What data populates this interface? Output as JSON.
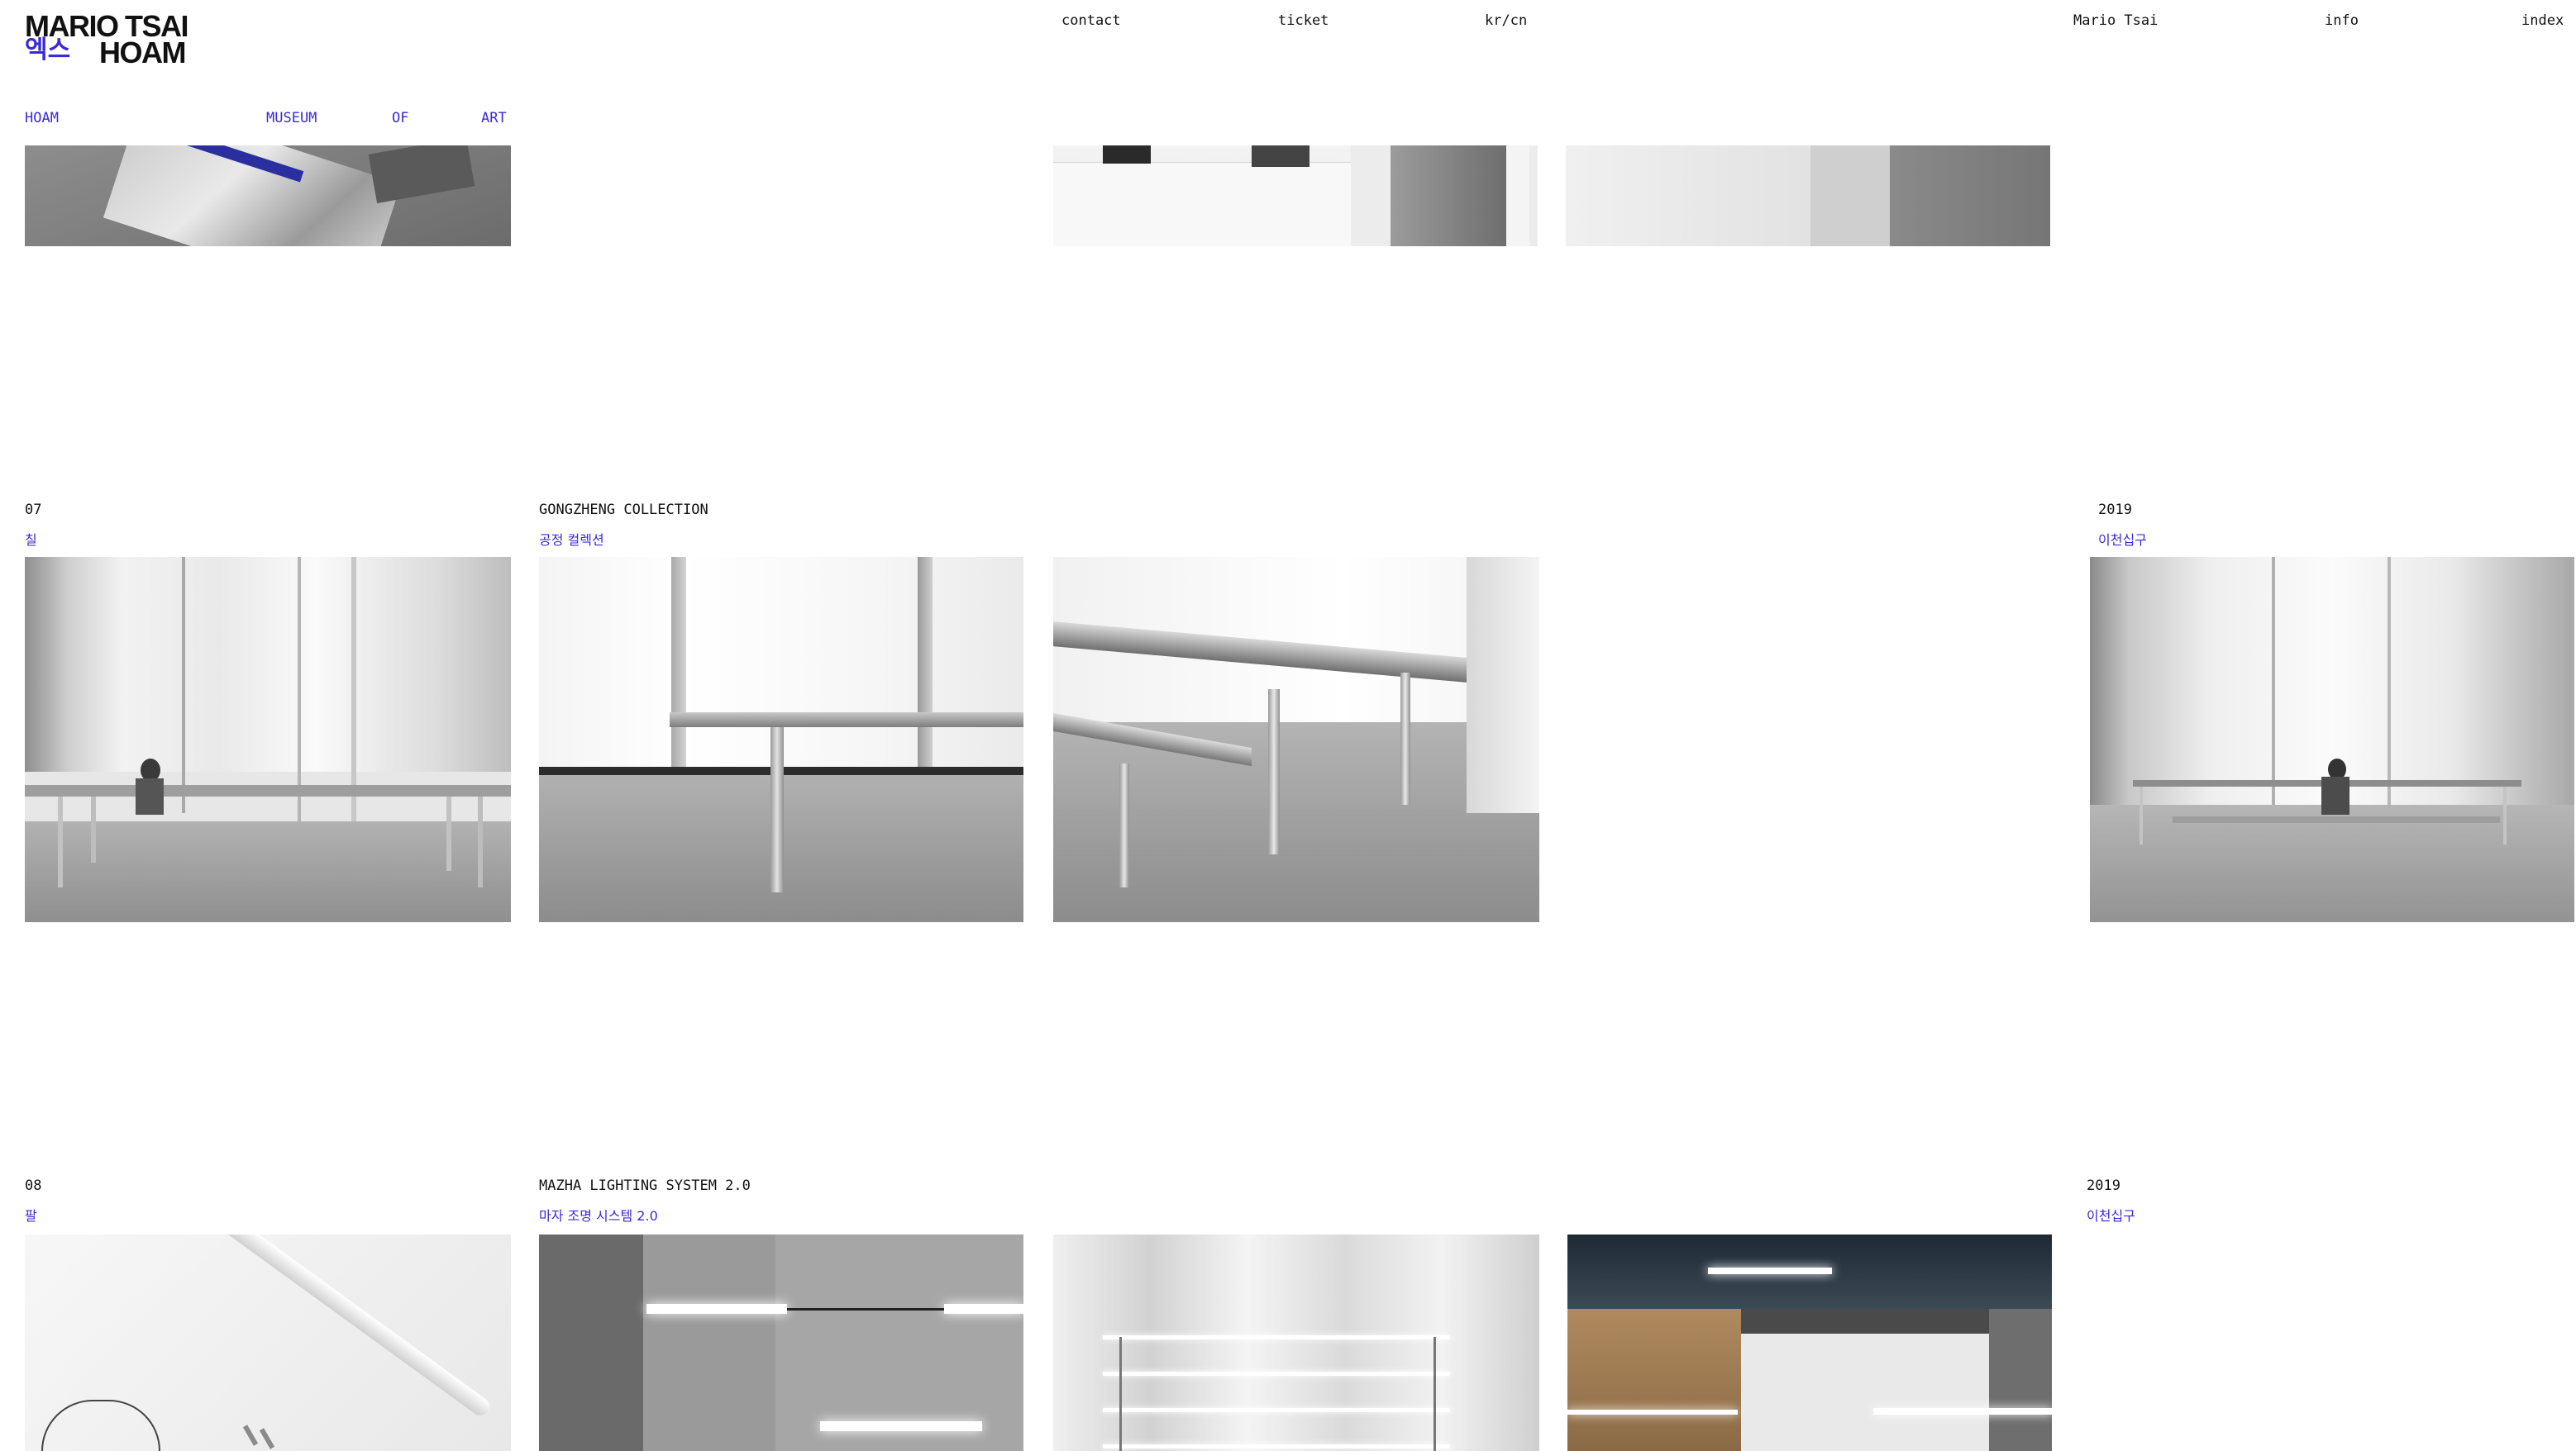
{
  "header": {
    "logo": {
      "line1": "MARIO TSAI",
      "ko": "엑스",
      "line2": "HOAM"
    },
    "nav": {
      "contact": "contact",
      "ticket": "ticket",
      "lang_kr": "kr/",
      "lang_cn": "cn"
    },
    "right_nav": {
      "artist": "Mario Tsai",
      "info": "info",
      "index": "index"
    }
  },
  "venue": [
    "HOAM",
    "MUSEUM",
    "OF",
    "ART"
  ],
  "works": [
    {
      "number": "07",
      "number_ko": "칠",
      "title": "GONGZHENG COLLECTION",
      "title_ko": "공정 컬렉션",
      "year": "2019",
      "place_ko": "이천십구"
    },
    {
      "number": "08",
      "number_ko": "팔",
      "title": "MAZHA LIGHTING SYSTEM 2.0",
      "title_ko": "마자 조명 시스템 2.0",
      "year": "2019",
      "place_ko": "이천십구"
    }
  ],
  "colors": {
    "accent": "#3a2bd6",
    "text": "#111111",
    "background": "#ffffff"
  }
}
